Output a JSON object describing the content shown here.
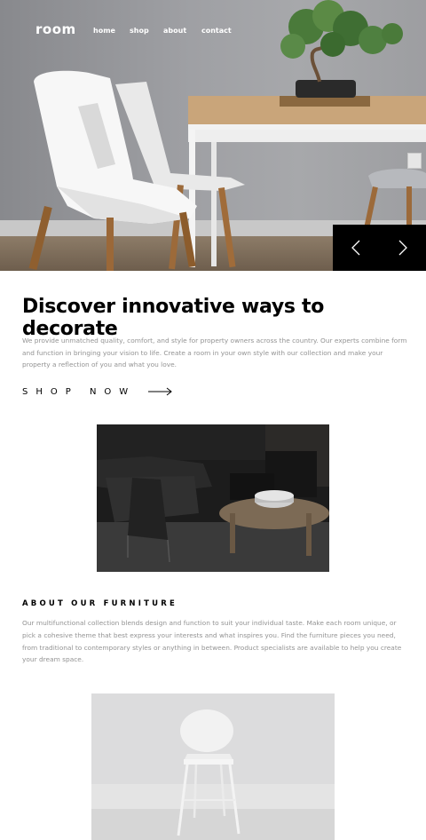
{
  "brand": {
    "logo": "room"
  },
  "nav": {
    "links": [
      {
        "label": "home"
      },
      {
        "label": "shop"
      },
      {
        "label": "about"
      },
      {
        "label": "contact"
      }
    ]
  },
  "slider": {
    "prev_icon": "chevron-left-icon",
    "next_icon": "chevron-right-icon"
  },
  "discover": {
    "title": "Discover innovative ways to decorate",
    "body": "We provide unmatched quality, comfort, and style for property owners across the country. Our experts combine form and function in bringing your vision to life. Create a room in your own style with our collection and make your property a reflection of you and what you love.",
    "cta_label": "SHOP NOW",
    "cta_icon": "arrow-right-icon"
  },
  "about": {
    "title": "ABOUT OUR FURNITURE",
    "body": "Our multifunctional collection blends design and function to suit your individual taste. Make each room unique, or pick a cohesive theme that best express your interests and what inspires you. Find the furniture pieces you need, from traditional to contemporary styles or anything in between. Product specialists are available to help you create your dream space."
  },
  "colors": {
    "text": "#000000",
    "body_text": "#939393",
    "slider_bg": "#000000",
    "background": "#ffffff"
  }
}
